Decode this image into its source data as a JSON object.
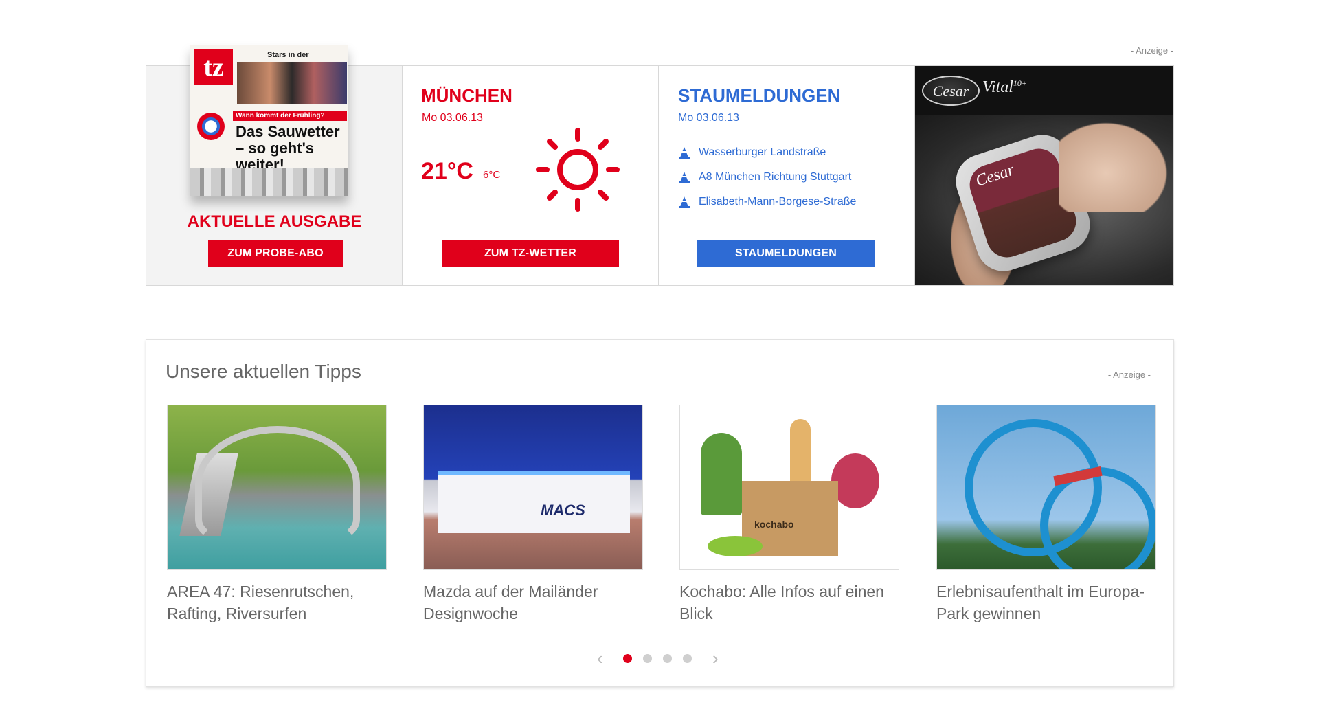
{
  "ad_label_top": "- Anzeige -",
  "issue": {
    "newspaper_logo": "tz",
    "newspaper_stars": "Stars in der",
    "newspaper_strip": "Wann kommt der Frühling?",
    "newspaper_headline": "Das Sauwetter – so geht's weiter!",
    "title": "AKTUELLE AUSGABE",
    "button": "ZUM PROBE-ABO"
  },
  "weather": {
    "city": "MÜNCHEN",
    "date": "Mo 03.06.13",
    "temp_high": "21°C",
    "temp_low": "6°C",
    "icon": "sun-icon",
    "button": "ZUM TZ-WETTER"
  },
  "traffic": {
    "title": "STAUMELDUNGEN",
    "date": "Mo 03.06.13",
    "items": [
      "Wasserburger Landstraße",
      "A8 München Richtung Stuttgart",
      "Elisabeth-Mann-Borgese-Straße"
    ],
    "icon": "traffic-cone-icon",
    "button": "STAUMELDUNGEN"
  },
  "ad": {
    "brand": "Cesar",
    "product": "Vital",
    "product_sup": "10+"
  },
  "tips": {
    "heading": "Unsere aktuellen Tipps",
    "ad_label": "- Anzeige -",
    "cards": [
      {
        "text": "AREA 47: Riesenrutschen, Rafting, Riversurfen"
      },
      {
        "text": "Mazda auf der Mailänder Designwoche",
        "image_label": "MACS"
      },
      {
        "text": "Kochabo: Alle Infos auf einen Blick",
        "image_label": "kochabo"
      },
      {
        "text": "Erlebnisaufenthalt im Europa-Park gewinnen"
      }
    ],
    "pager": {
      "prev": "‹",
      "next": "›",
      "pages": 4,
      "active": 1
    }
  },
  "colors": {
    "red": "#e0001b",
    "blue": "#2e6bd4",
    "grey_text": "#666666"
  }
}
